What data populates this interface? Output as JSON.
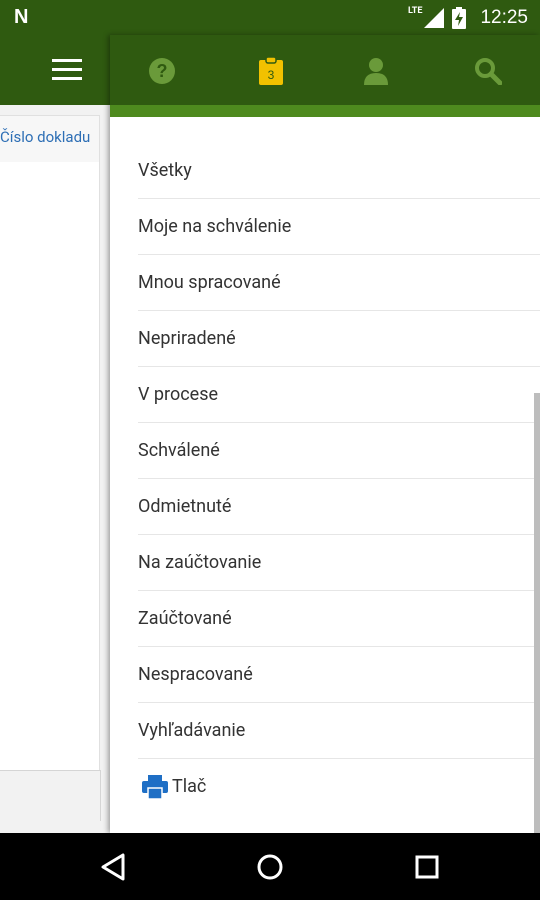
{
  "status_bar": {
    "network": "LTE",
    "time": "12:25"
  },
  "left_panel": {
    "column_header": "Číslo dokladu"
  },
  "tabs": [
    {
      "icon": "help-icon",
      "color": "#6a9a3a"
    },
    {
      "icon": "clipboard-icon",
      "badge": "3",
      "color": "#f2c100"
    },
    {
      "icon": "user-icon",
      "color": "#6a9a3a"
    },
    {
      "icon": "search-icon",
      "color": "#6a9a3a"
    }
  ],
  "menu": {
    "items": [
      "Všetky",
      "Moje na schválenie",
      "Mnou spracované",
      "Nepriradené",
      "V procese",
      "Schválené",
      "Odmietnuté",
      "Na zaúčtovanie",
      "Zaúčtované",
      "Nespracované",
      "Vyhľadávanie"
    ],
    "print_label": "Tlač"
  },
  "colors": {
    "app_bar": "#2f5a10",
    "accent_stripe": "#4e8a1e",
    "link": "#2e6fb5"
  }
}
